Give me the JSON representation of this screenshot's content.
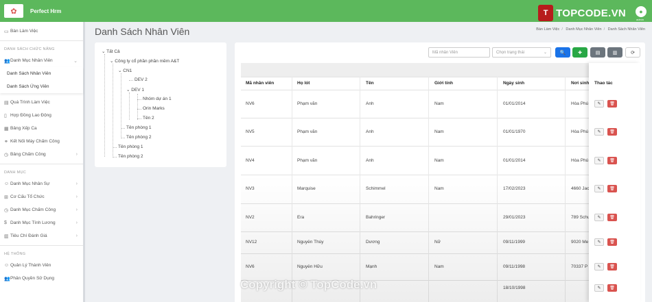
{
  "app": {
    "name": "Perfect Hrm",
    "user_label": "admin"
  },
  "brand": {
    "badge": "T",
    "text": "TOPCODE.VN"
  },
  "sidebar": {
    "top_item": "Bàn Làm Việc",
    "section1": "DANH SÁCH CHỨC NĂNG",
    "group": "Danh Mục Nhân Viên",
    "sub1": "Danh Sách Nhân Viên",
    "sub2": "Danh Sách Ứng Viên",
    "items": [
      "Quá Trình Làm Việc",
      "Hợp Đồng Lao Động",
      "Bảng Xếp Ca",
      "Kết Nối Máy Chấm Công",
      "Bảng Chấm Công"
    ],
    "section2": "DANH MỤC",
    "items2": [
      "Danh Mục Nhân Sự",
      "Cơ Cấu Tổ Chức",
      "Danh Mục Chấm Công",
      "Danh Mục Tính Lương",
      "Tiêu Chí Đánh Giá"
    ],
    "section3": "HỆ THỐNG",
    "items3": [
      "Quản Lý Thành Viên",
      "Phân Quyền Sử Dụng"
    ]
  },
  "page": {
    "title": "Danh Sách Nhân Viên"
  },
  "breadcrumb": [
    "Bàn Làm Việc",
    "Danh Mục Nhân Viên",
    "Danh Sách Nhân Viên"
  ],
  "tree": {
    "root": "Tất Cả",
    "company": "Công ty cổ phần phần mềm A&T",
    "cn1": "CN1",
    "dev2": "DEV 2",
    "dev1": "DEV 1",
    "n1": "Nhóm dự án 1",
    "n2": "Orin Marks",
    "n3": "Tên 2",
    "p1": "Tên phòng 1",
    "p2": "Tên phòng 2",
    "p3": "Tên phòng 1",
    "p4": "Tên phòng 2"
  },
  "filters": {
    "search_placeholder": "Mã nhân Viên",
    "status_placeholder": "Chọn trạng thái"
  },
  "table": {
    "headers": [
      "Mã nhân viên",
      "Họ lót",
      "Tên",
      "Giới tính",
      "Ngày sinh",
      "Nơi sinh",
      "Thao tác"
    ],
    "rows": [
      [
        "NV6",
        "Phạm văn",
        "Anh",
        "Nam",
        "01/01/2014",
        "Hòa Phú"
      ],
      [
        "NV5",
        "Phạm văn",
        "Anh",
        "Nam",
        "01/01/1970",
        "Hòa Phú"
      ],
      [
        "NV4",
        "Phạm văn",
        "Anh",
        "Nam",
        "01/01/2014",
        "Hòa Phú"
      ],
      [
        "NV3",
        "Marquise",
        "Schimmel",
        "Nam",
        "17/02/2023",
        "4660 Jac"
      ],
      [
        "NV2",
        "Era",
        "Bahringer",
        "",
        "29/01/2023",
        "789 Schu"
      ],
      [
        "NV12",
        "Nguyễn Thúy",
        "Dương",
        "Nữ",
        "09/11/1999",
        "9020 Me"
      ],
      [
        "NV6",
        "Nguyễn Hữu",
        "Mạnh",
        "Nam",
        "09/11/1998",
        "70337 P"
      ],
      [
        "",
        "",
        "",
        "",
        "18/10/1998",
        ""
      ]
    ]
  },
  "watermark": "Copyright © TopCode.vn"
}
